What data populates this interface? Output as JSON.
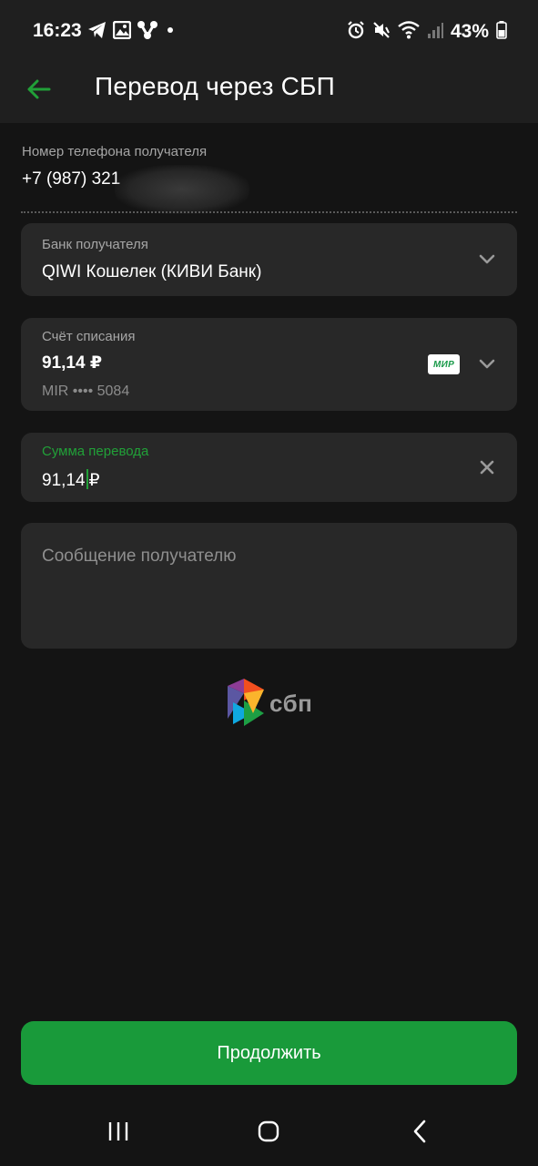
{
  "status_bar": {
    "time": "16:23",
    "battery": "43%",
    "left_icons": [
      "telegram-icon",
      "gallery-icon",
      "app-icon",
      "dot-icon"
    ],
    "right_icons": [
      "alarm-icon",
      "mute-icon",
      "wifi-icon",
      "signal-icon",
      "battery-icon"
    ]
  },
  "header": {
    "title": "Перевод через СБП",
    "back_icon": "arrow-left-icon"
  },
  "phone": {
    "label": "Номер телефона получателя",
    "value": "+7 (987) 321"
  },
  "bank": {
    "label": "Банк получателя",
    "value": "QIWI Кошелек (КИВИ Банк)"
  },
  "account": {
    "label": "Счёт списания",
    "balance": "91,14 ₽",
    "card": "MIR •••• 5084",
    "card_brand": "МИР"
  },
  "amount": {
    "label": "Сумма перевода",
    "value_main": "91,14",
    "value_currency": "₽"
  },
  "message": {
    "placeholder": "Сообщение получателю"
  },
  "sbp": {
    "text": "сбп"
  },
  "continue_button": {
    "label": "Продолжить"
  },
  "colors": {
    "accent": "#21a038",
    "button": "#199a3a",
    "background": "#141414",
    "card": "#282828"
  }
}
